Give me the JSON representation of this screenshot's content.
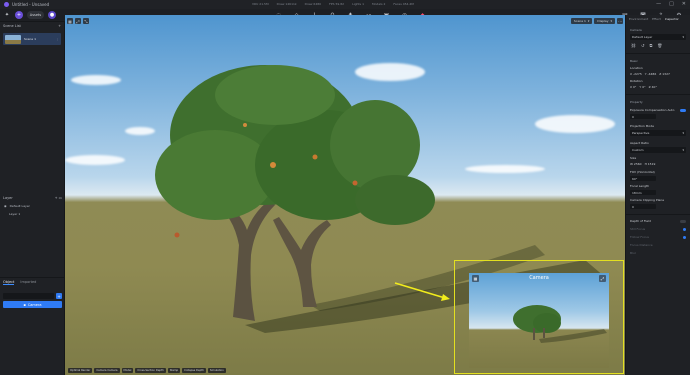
{
  "titlebar": {
    "title": "Untitled - Unsaved",
    "stats": [
      "VRU 21.5M",
      "Draw 14611k",
      "Draw 6480",
      "FPS 59.82",
      "Lights 1",
      "Models 2",
      "Faces 454.4M"
    ],
    "controls": [
      "—",
      "□",
      "✕"
    ]
  },
  "toolbar": {
    "assets_label": "Assets",
    "center_icons": [
      "bulb-icon",
      "diamond-icon",
      "brush-icon",
      "pin-icon",
      "tree-icon",
      "route-icon",
      "cube-icon",
      "target-icon",
      "car-icon"
    ],
    "right_icons": [
      "save-icon",
      "camera-icon",
      "export-icon",
      "gear-icon"
    ]
  },
  "left_panel": {
    "scene_list_label": "Scene List",
    "scene_name": "Scene 1",
    "layer_label": "Layer",
    "layers": [
      "Default Layer",
      "Layer 1"
    ],
    "tab_object": "Object",
    "tab_imported": "Imported",
    "camera_button": "Camera"
  },
  "viewport": {
    "scene_select": "Scene 1",
    "display_select": "Display",
    "bottom_chips": [
      "Optimal Render",
      "Camera Camera",
      "Model",
      "Cross-Section Depth",
      "Stamp",
      "Collapse Depth",
      "Simulation"
    ],
    "camera_preview_title": "Camera"
  },
  "right_panel": {
    "tabs": [
      "Environment",
      "Effect",
      "Inspector"
    ],
    "camera_label": "Camera",
    "default_layer": "Default Layer",
    "basic_label": "Basic",
    "location_label": "Location",
    "location": [
      "X -2275",
      "Y -4486",
      "Z 1327"
    ],
    "rotation_label": "Rotation",
    "rotation": [
      "X 0°",
      "Y 0°",
      "Z 40°"
    ],
    "property_label": "Property",
    "exposure_label": "Exposure Compensation Auto",
    "exposure_value": "0",
    "projection_label": "Projection Mode",
    "projection_value": "Perspective",
    "aspect_label": "Aspect Ratio",
    "aspect_value": "Custom",
    "size_label": "Size",
    "size_w": "W 2560",
    "size_h": "H 1519",
    "fov_label": "FOV (Horizontal)",
    "fov_value": "60°",
    "focal_label": "Focal Length",
    "focal_value": "18mm",
    "clip_label": "Camera Clipping Plane",
    "clip_value": "0",
    "dof_label": "Depth of Field",
    "dof_fields": [
      "Still Focus",
      "Follow Focus",
      "Focus Distance",
      "Blur"
    ]
  }
}
